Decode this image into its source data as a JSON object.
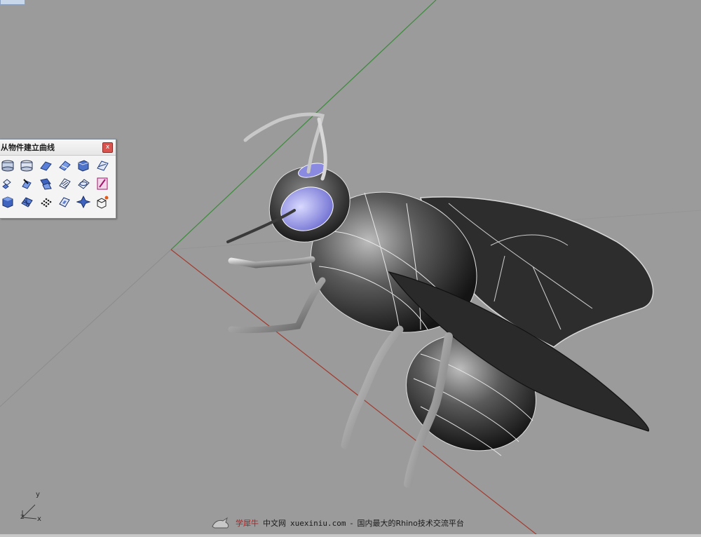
{
  "viewport": {
    "background": "#9b9b9b",
    "x_axis_color": "#a33a2e",
    "y_axis_color": "#3a8a3a",
    "model": "bee"
  },
  "toolbar": {
    "title": "从物件建立曲线",
    "close_glyph": "x",
    "buttons": [
      {
        "name": "duplicate-edge-icon"
      },
      {
        "name": "duplicate-border-icon"
      },
      {
        "name": "duplicate-face-border-icon"
      },
      {
        "name": "extract-isocurve-icon"
      },
      {
        "name": "extract-wireframe-icon"
      },
      {
        "name": "extract-curvature-curve-icon"
      },
      {
        "name": "project-curve-icon"
      },
      {
        "name": "pull-curve-icon"
      },
      {
        "name": "intersect-icon"
      },
      {
        "name": "contour-icon"
      },
      {
        "name": "section-icon"
      },
      {
        "name": "silhouette-icon"
      },
      {
        "name": "create-uv-curves-icon"
      },
      {
        "name": "mesh-outline-icon"
      },
      {
        "name": "point-cloud-curve-icon"
      },
      {
        "name": "unroll-icon"
      },
      {
        "name": "mesh-intersect-icon"
      },
      {
        "name": "make-2d-icon"
      }
    ]
  },
  "axis_triad": {
    "y": "y",
    "z": "z",
    "x": "x"
  },
  "watermark": {
    "brand": "学犀牛",
    "name": "中文网",
    "site": "xuexiniu.com",
    "separator": "-",
    "tagline": "国内最大的Rhino技术交流平台"
  }
}
